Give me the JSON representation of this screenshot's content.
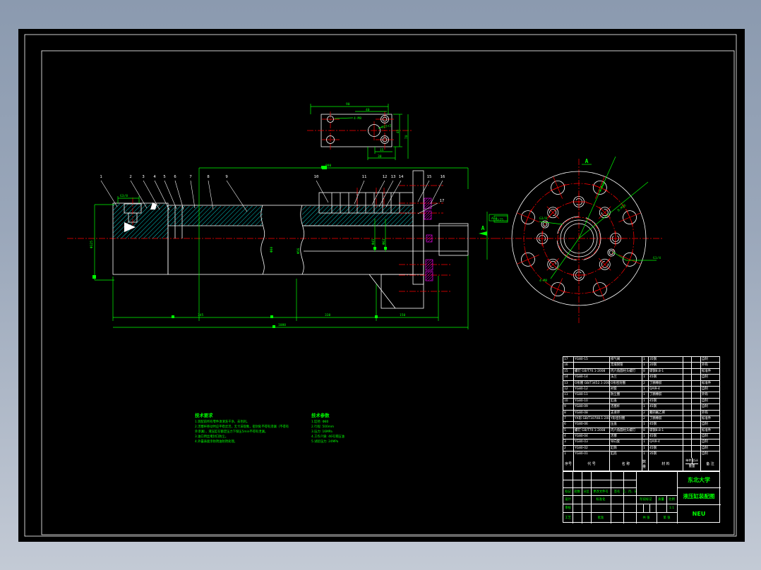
{
  "colors": {
    "background_top": "#8b9aaf",
    "background_bottom": "#c3cad5",
    "canvas": "#000000",
    "outline": "#ffffff",
    "hatch": "#00dede",
    "centerline": "#ff0000",
    "dimension": "#00ff00",
    "seal": "#ff00ff"
  },
  "detail_view": {
    "dims": {
      "d1": "90",
      "d2": "40",
      "d3": "45",
      "d4": "70",
      "d5": "15",
      "d6": "30",
      "hole": "4-M8",
      "center_hole": "M27×2"
    }
  },
  "main_view": {
    "part_numbers": [
      "1",
      "2",
      "3",
      "4",
      "5",
      "6",
      "7",
      "8",
      "9",
      "10",
      "11",
      "12",
      "13",
      "14",
      "15",
      "16",
      "17"
    ],
    "dims": {
      "overall_top": "880",
      "left_dia": "Φ125",
      "port": "G3/8",
      "dia1": "Φ80",
      "dia2": "Φ56",
      "dia3": "Φ45",
      "dia4": "Φ63",
      "c1": "345",
      "c2": "338",
      "c3": "150",
      "overall_bottom": "1080",
      "section_box": "A—A"
    }
  },
  "section_view": {
    "letter": "A",
    "labels": {
      "bolts_outer": "8-Φ18",
      "bolts_inner": "8-M16",
      "port_left": "G3/8",
      "port_right": "G1/4",
      "ports_small": "4-M8",
      "rough_box": "Rz25"
    }
  },
  "notes": {
    "tech_requirements": {
      "title": "技术要求",
      "lines": [
        "1.装配前所有零件须清洗干净，去毛刺。",
        "2.活塞杆移动时应平稳灵活，无卡滞现象，密封处不得有渗漏（不得有",
        "外渗漏），液压缸在额定压力下保压5min不得有泄漏。",
        "3.油口用丝堵封口防尘。",
        "4.外露表面涂防锈油防锈处理。"
      ]
    },
    "tech_parameters": {
      "title": "技术参数",
      "lines": [
        "1.缸径: Φ80",
        "2.行程: 500mm",
        "3.压力: 16MPa",
        "4.工作介质: 46号液压油",
        "5.试验压力: 24MPa"
      ]
    }
  },
  "bom": {
    "headers": {
      "no": "序号",
      "code": "代 号",
      "name": "名 称",
      "qty": "数量",
      "material": "材 料",
      "w_single": "单件",
      "w_total": "总计",
      "weight": "重量",
      "remark": "备 注"
    },
    "rows": [
      {
        "no": "17",
        "code": "YG80-15",
        "name": "排气阀",
        "qty": "1",
        "material": "35钢",
        "ws": "",
        "wt": "",
        "remark": "自制"
      },
      {
        "no": "16",
        "code": "",
        "name": "无缝钢管",
        "qty": "1",
        "material": "20钢",
        "ws": "",
        "wt": "",
        "remark": "外购"
      },
      {
        "no": "15",
        "code": "螺钉 GB/T70.1-2008",
        "name": "内六角圆柱头螺钉",
        "qty": "8",
        "material": "碳钢8.8-1",
        "ws": "",
        "wt": "",
        "remark": "标准件"
      },
      {
        "no": "14",
        "code": "YG80-14",
        "name": "法兰",
        "qty": "1",
        "material": "45钢",
        "ws": "",
        "wt": "",
        "remark": "自制"
      },
      {
        "no": "13",
        "code": "O形圈 GB/T3452.1-2005",
        "name": "O形密封圈",
        "qty": "2",
        "material": "丁腈橡胶",
        "ws": "",
        "wt": "",
        "remark": "标准件"
      },
      {
        "no": "12",
        "code": "YG80-12",
        "name": "衬套",
        "qty": "1",
        "material": "QAl9-4",
        "ws": "",
        "wt": "",
        "remark": "自制"
      },
      {
        "no": "11",
        "code": "YG80-11",
        "name": "防尘圈",
        "qty": "1",
        "material": "丁腈橡胶",
        "ws": "",
        "wt": "",
        "remark": "外购"
      },
      {
        "no": "10",
        "code": "YG80-10",
        "name": "缸盖",
        "qty": "1",
        "material": "45钢",
        "ws": "",
        "wt": "",
        "remark": "自制"
      },
      {
        "no": "9",
        "code": "YG80-09",
        "name": "活塞杆",
        "qty": "1",
        "material": "45钢",
        "ws": "",
        "wt": "",
        "remark": "自制"
      },
      {
        "no": "8",
        "code": "YG80-08",
        "name": "支承环",
        "qty": "2",
        "material": "聚四氟乙烯",
        "ws": "",
        "wt": "",
        "remark": "外购"
      },
      {
        "no": "7",
        "code": "YX形 GB/T10708.1-2008",
        "name": "Y形密封圈",
        "qty": "2",
        "material": "丁腈橡胶",
        "ws": "",
        "wt": "",
        "remark": "标准件"
      },
      {
        "no": "6",
        "code": "YG80-06",
        "name": "压盖",
        "qty": "1",
        "material": "45钢",
        "ws": "",
        "wt": "",
        "remark": "自制"
      },
      {
        "no": "5",
        "code": "螺钉 GB/T70.1-2008",
        "name": "内六角圆柱头螺钉",
        "qty": "8",
        "material": "碳钢8.8-1",
        "ws": "",
        "wt": "",
        "remark": "标准件"
      },
      {
        "no": "4",
        "code": "YG80-04",
        "name": "活塞",
        "qty": "1",
        "material": "45钢",
        "ws": "",
        "wt": "",
        "remark": "自制"
      },
      {
        "no": "3",
        "code": "YG80-03",
        "name": "导向套",
        "qty": "1",
        "material": "QAl9-4",
        "ws": "",
        "wt": "",
        "remark": "自制"
      },
      {
        "no": "2",
        "code": "YG80-02",
        "name": "缸筒",
        "qty": "1",
        "material": "45钢",
        "ws": "",
        "wt": "",
        "remark": "自制"
      },
      {
        "no": "1",
        "code": "YG80-01",
        "name": "缸底",
        "qty": "1",
        "material": "35钢",
        "ws": "",
        "wt": "",
        "remark": "自制"
      }
    ]
  },
  "title_block": {
    "school": "东北大学",
    "drawing_title": "液压缸装配图",
    "drawing_no": "NEU",
    "scale_value": "1:1",
    "labels": {
      "mark": "标记",
      "count": "处数",
      "zone": "分区",
      "change": "更改文件号",
      "sign": "签名",
      "date": "年、月、日",
      "design": "设计",
      "standard": "标准化",
      "check": "审核",
      "process": "工艺",
      "approve": "批准",
      "stage": "阶段标记",
      "weight": "质量",
      "scale": "比例",
      "sheets": "共 张",
      "sheet": "第 张"
    }
  }
}
